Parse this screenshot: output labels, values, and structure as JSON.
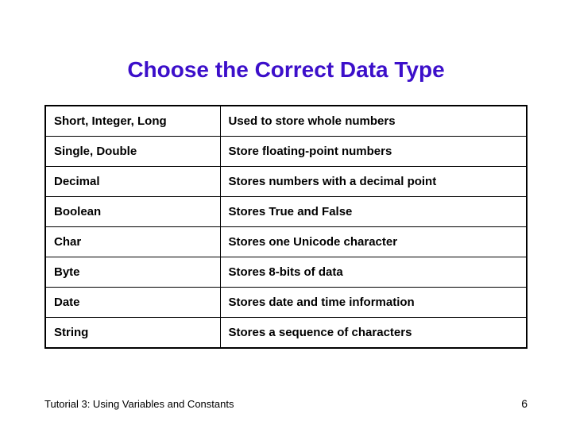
{
  "title": "Choose the Correct Data Type",
  "rows": [
    {
      "type": "Short, Integer, Long",
      "desc": "Used to store whole numbers"
    },
    {
      "type": "Single, Double",
      "desc": "Store floating-point numbers"
    },
    {
      "type": "Decimal",
      "desc": "Stores numbers with a decimal point"
    },
    {
      "type": "Boolean",
      "desc": "Stores True and False"
    },
    {
      "type": "Char",
      "desc": "Stores one Unicode character"
    },
    {
      "type": "Byte",
      "desc": "Stores 8-bits of data"
    },
    {
      "type": "Date",
      "desc": "Stores date and time information"
    },
    {
      "type": "String",
      "desc": "Stores a sequence of characters"
    }
  ],
  "footer": {
    "text": "Tutorial 3: Using Variables and Constants",
    "page": "6"
  }
}
